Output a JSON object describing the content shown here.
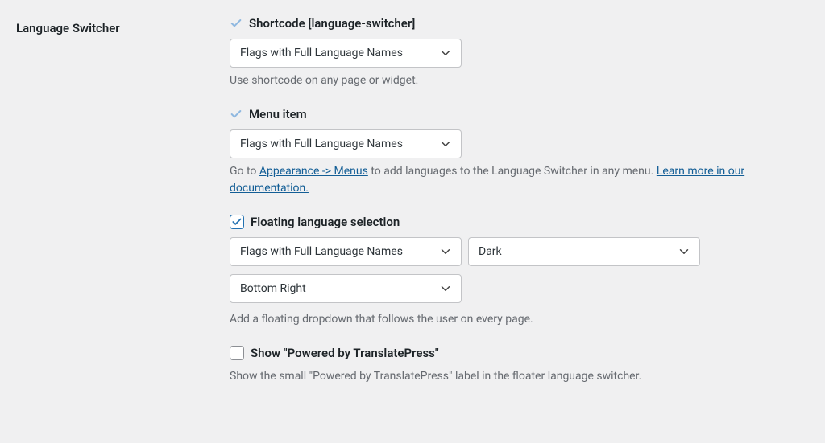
{
  "section_title": "Language Switcher",
  "shortcode": {
    "label": "Shortcode [language-switcher]",
    "select": "Flags with Full Language Names",
    "desc": "Use shortcode on any page or widget."
  },
  "menu_item": {
    "label": "Menu item",
    "select": "Flags with Full Language Names",
    "desc_before": "Go to ",
    "link1": "Appearance -> Menus",
    "desc_mid": " to add languages to the Language Switcher in any menu. ",
    "link2": "Learn more in our documentation."
  },
  "floating": {
    "label": "Floating language selection",
    "select_style": "Flags with Full Language Names",
    "select_theme": "Dark",
    "select_position": "Bottom Right",
    "desc": "Add a floating dropdown that follows the user on every page."
  },
  "powered_by": {
    "label": "Show \"Powered by TranslatePress\"",
    "desc": "Show the small \"Powered by TranslatePress\" label in the floater language switcher."
  }
}
